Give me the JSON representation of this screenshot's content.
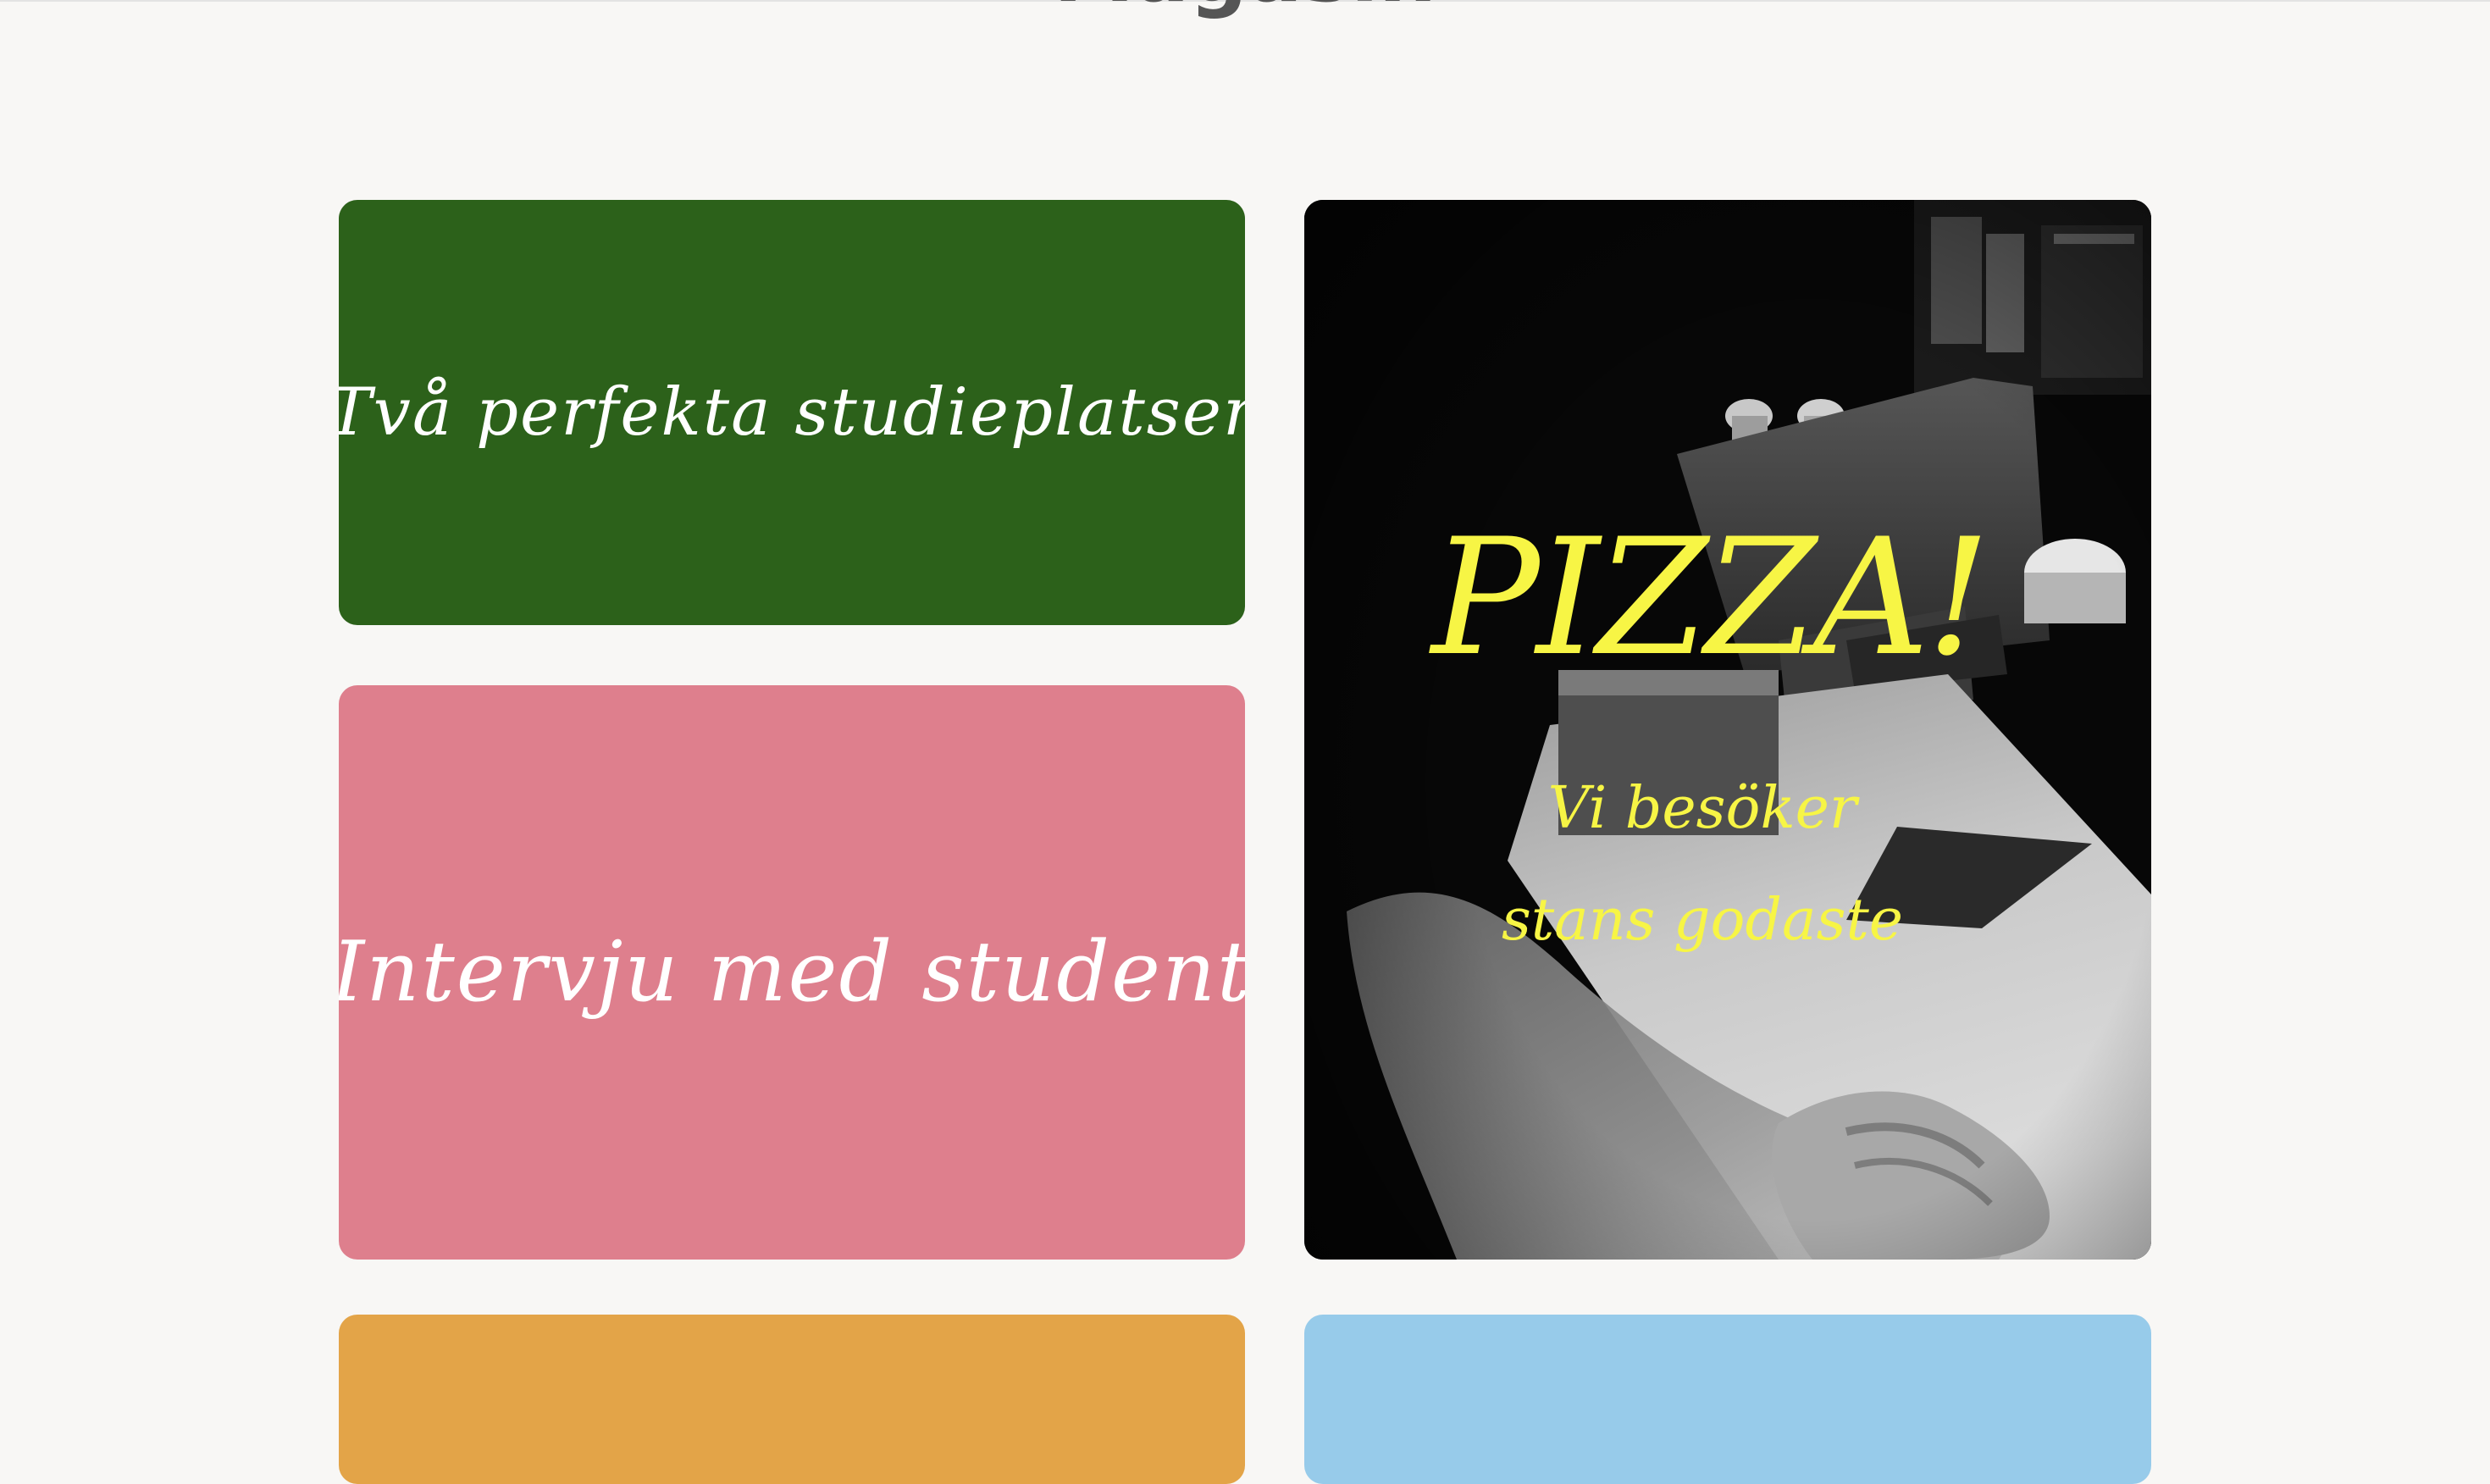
{
  "page": {
    "heading": "Magasin"
  },
  "cards": {
    "green": {
      "title": "Två perfekta studieplatser",
      "color": "#2c611a"
    },
    "pink": {
      "title": "Intervju med student",
      "color": "#de7f8d"
    },
    "pizza": {
      "headline": "PIZZA!",
      "subline_1": "Vi besöker",
      "subline_2": "stans godaste",
      "text_color": "#f7f545"
    },
    "orange": {
      "color": "#e3a448"
    },
    "blue": {
      "color": "#97cbea"
    }
  }
}
